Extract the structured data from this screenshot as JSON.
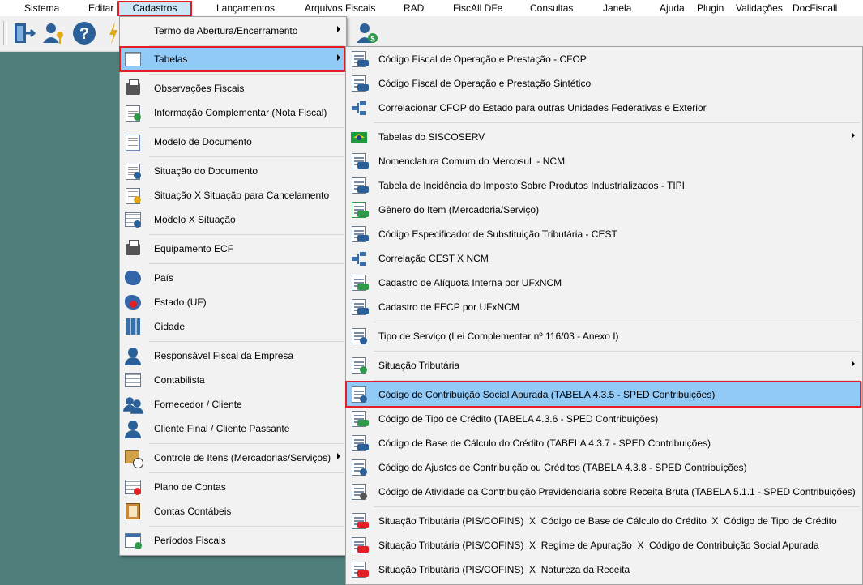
{
  "menubar": {
    "items": [
      "Sistema",
      "Editar",
      "Cadastros",
      "Lançamentos",
      "Arquivos Fiscais",
      "RAD",
      "FiscAll DFe",
      "Consultas",
      "Janela",
      "Ajuda",
      "Plugin",
      "Validações",
      "DocFiscall"
    ]
  },
  "cadastros_menu": {
    "items": [
      {
        "label": "Termo de Abertura/Encerramento",
        "icon": "blank-icon",
        "submenu": true
      },
      {
        "label": "Tabelas",
        "icon": "table-icon",
        "submenu": true
      },
      {
        "label": "Observações Fiscais",
        "icon": "fax-icon"
      },
      {
        "label": "Informação Complementar (Nota Fiscal)",
        "icon": "document-add-icon"
      },
      {
        "label": "Modelo de Documento",
        "icon": "document-icon"
      },
      {
        "label": "Situação do Documento",
        "icon": "document-info-icon"
      },
      {
        "label": "Situação X Situação para Cancelamento",
        "icon": "document-warning-icon"
      },
      {
        "label": "Modelo X Situação",
        "icon": "table-info-icon"
      },
      {
        "label": "Equipamento ECF",
        "icon": "ecf-icon"
      },
      {
        "label": "País",
        "icon": "brazil-map-icon"
      },
      {
        "label": "Estado (UF)",
        "icon": "state-map-icon"
      },
      {
        "label": "Cidade",
        "icon": "city-icon"
      },
      {
        "label": "Responsável Fiscal da Empresa",
        "icon": "person-icon"
      },
      {
        "label": "Contabilista",
        "icon": "spreadsheet-icon"
      },
      {
        "label": "Fornecedor / Cliente",
        "icon": "people-icon"
      },
      {
        "label": "Cliente Final / Cliente Passante",
        "icon": "person-icon"
      },
      {
        "label": "Controle de Itens (Mercadorias/Serviços)",
        "icon": "box-clock-icon",
        "submenu": true
      },
      {
        "label": "Plano de Contas",
        "icon": "chart-of-accounts-icon"
      },
      {
        "label": "Contas Contábeis",
        "icon": "ledger-icon"
      },
      {
        "label": "Períodos Fiscais",
        "icon": "calendar-money-icon"
      }
    ]
  },
  "tabelas_menu": {
    "items": [
      {
        "label": "Código Fiscal de Operação e Prestação - CFOP",
        "icon": "cfop-icon"
      },
      {
        "label": "Código Fiscal de Operação e Prestação Sintético",
        "icon": "cfop-icon"
      },
      {
        "label": "Correlacionar CFOP do Estado para outras Unidades Federativas e Exterior",
        "icon": "relation-icon"
      },
      {
        "label": "Tabelas do SISCOSERV",
        "icon": "brazil-flag-icon",
        "submenu": true
      },
      {
        "label": "Nomenclatura Comum do Mercosul  - NCM",
        "icon": "ncm-icon"
      },
      {
        "label": "Tabela de Incidência do Imposto Sobre Produtos Industrializados - TIPI",
        "icon": "tipi-icon"
      },
      {
        "label": "Gênero do Item (Mercadoria/Serviço)",
        "icon": "money-sheet-icon"
      },
      {
        "label": "Código Especificador de Substituição Tributária - CEST",
        "icon": "cest-icon"
      },
      {
        "label": "Correlação CEST X NCM",
        "icon": "relation-icon"
      },
      {
        "label": "Cadastro de Alíquota Interna por UFxNCM",
        "icon": "rate-icon"
      },
      {
        "label": "Cadastro de FECP por UFxNCM",
        "icon": "fecp-icon"
      },
      {
        "label": "Tipo de Serviço (Lei Complementar nº 116/03 - Anexo I)",
        "icon": "service-info-icon"
      },
      {
        "label": "Situação Tributária",
        "icon": "percent-sheet-icon",
        "submenu": true
      },
      {
        "label": "Código de Contribuição Social Apurada (TABELA 4.3.5 - SPED Contribuições)",
        "icon": "contribution-icon"
      },
      {
        "label": "Código de Tipo de Crédito (TABELA 4.3.6 - SPED Contribuições)",
        "icon": "credit-icon"
      },
      {
        "label": "Código de Base de Cálculo do Crédito (TABELA 4.3.7 - SPED Contribuições)",
        "icon": "calc-base-icon"
      },
      {
        "label": "Código de Ajustes de Contribuição ou Créditos (TABELA 4.3.8 - SPED Contribuições)",
        "icon": "adjust-icon"
      },
      {
        "label": "Código de Atividade da Contribuição Previdenciária sobre Receita Bruta (TABELA 5.1.1 - SPED Contribuições)",
        "icon": "activity-icon"
      },
      {
        "label": "Situação Tributária (PIS/COFINS)  X  Código de Base de Cálculo do Crédito  X  Código de Tipo de Crédito",
        "icon": "pis-icon"
      },
      {
        "label": "Situação Tributária (PIS/COFINS)  X  Regime de Apuração  X  Código de Contribuição Social Apurada",
        "icon": "pis-icon"
      },
      {
        "label": "Situação Tributária (PIS/COFINS)  X  Natureza da Receita",
        "icon": "pis-icon"
      }
    ]
  },
  "colors": {
    "highlight": "#91c9f7",
    "annotation": "#e31e24",
    "desktop": "#4f7f7a"
  }
}
